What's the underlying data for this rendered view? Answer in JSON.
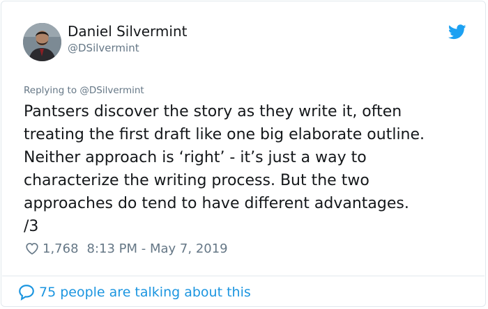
{
  "tweet": {
    "author_name": "Daniel Silvermint",
    "author_handle": "@DSilvermint",
    "replying_to": "Replying to @DSilvermint",
    "text": "Pantsers discover the story as they write it, often\ntreating the first draft like one big elaborate outline.\nNeither approach is ‘right’ - it’s just a way to\ncharacterize the writing process. But the two\napproaches do tend to have different advantages.\n/3",
    "likes": "1,768",
    "timestamp": "8:13 PM - May 7, 2019",
    "talking": "75 people are talking about this"
  },
  "icons": {
    "bird": "twitter-bird-icon",
    "heart": "heart-icon",
    "bubble": "speech-bubble-icon"
  },
  "colors": {
    "accent": "#1da1f2",
    "link": "#1b95e0",
    "muted": "#657786",
    "text": "#14171a",
    "border": "#e1e8ed"
  }
}
